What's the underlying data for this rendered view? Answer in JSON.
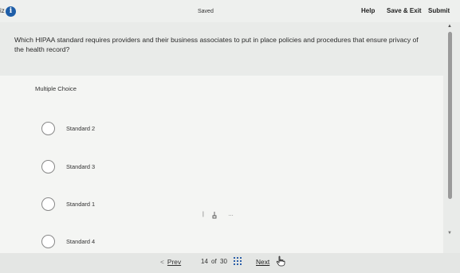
{
  "header": {
    "quiz_tag": "iz",
    "info_icon": "info-icon",
    "info_glyph": "i",
    "status": "Saved",
    "help_label": "Help",
    "save_exit_label": "Save & Exit",
    "submit_label": "Submit"
  },
  "question": {
    "text": "Which HIPAA standard requires providers and their business associates to put in place policies and procedures that ensure privacy of the health record?"
  },
  "answers": {
    "type_label": "Multiple Choice",
    "options": [
      {
        "label": "Standard 2",
        "selected": false
      },
      {
        "label": "Standard 3",
        "selected": false
      },
      {
        "label": "Standard 1",
        "selected": false
      },
      {
        "label": "Standard 4",
        "selected": false
      }
    ]
  },
  "mini_toolbar": {
    "divider": "|",
    "pointer_icon": "hand-pointer-icon",
    "more": "…"
  },
  "footer": {
    "prev_label": "Prev",
    "current_page": "14",
    "of_label": "of",
    "total_pages": "30",
    "grid_icon": "grid-icon",
    "next_label": "Next",
    "cursor_icon": "hand-cursor-icon"
  },
  "colors": {
    "accent": "#1e5ea8",
    "background": "#e9ebe9",
    "panel": "#f4f5f3"
  }
}
